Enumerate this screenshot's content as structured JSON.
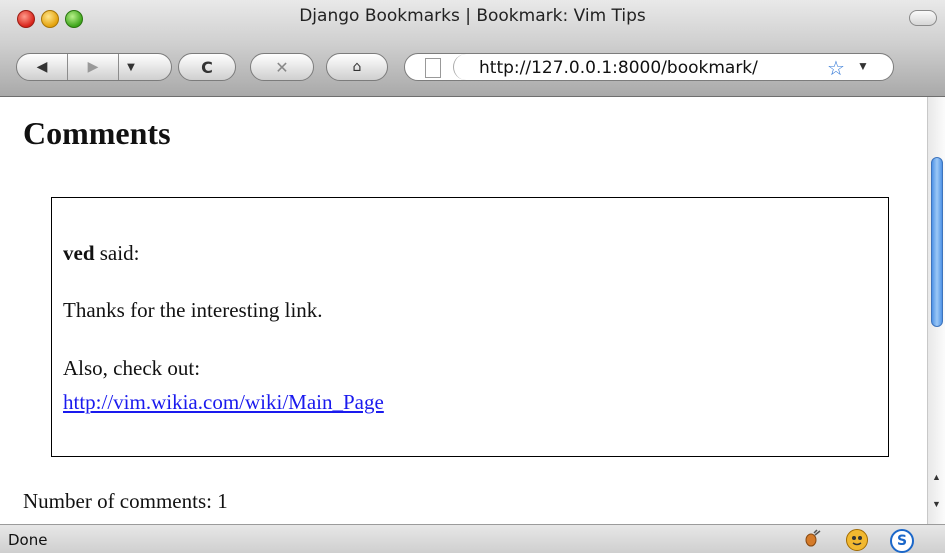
{
  "window": {
    "title": "Django Bookmarks | Bookmark: Vim Tips"
  },
  "toolbar": {
    "back_icon": "◀",
    "forward_icon": "▶",
    "history_icon": "▼",
    "reload_icon": "C",
    "stop_icon": "✕",
    "home_icon": "⌂",
    "url": "http://127.0.0.1:8000/bookmark/",
    "bookmark_star": "☆",
    "url_dropdown": "▼"
  },
  "content": {
    "heading": "Comments",
    "comment": {
      "author": "ved",
      "said_label": "said:",
      "line1": "Thanks for the interesting link.",
      "line2": "Also, check out:",
      "link": "http://vim.wikia.com/wiki/Main_Page"
    },
    "count_label": "Number of comments: 1"
  },
  "status": {
    "text": "Done",
    "icon3_label": "S"
  }
}
